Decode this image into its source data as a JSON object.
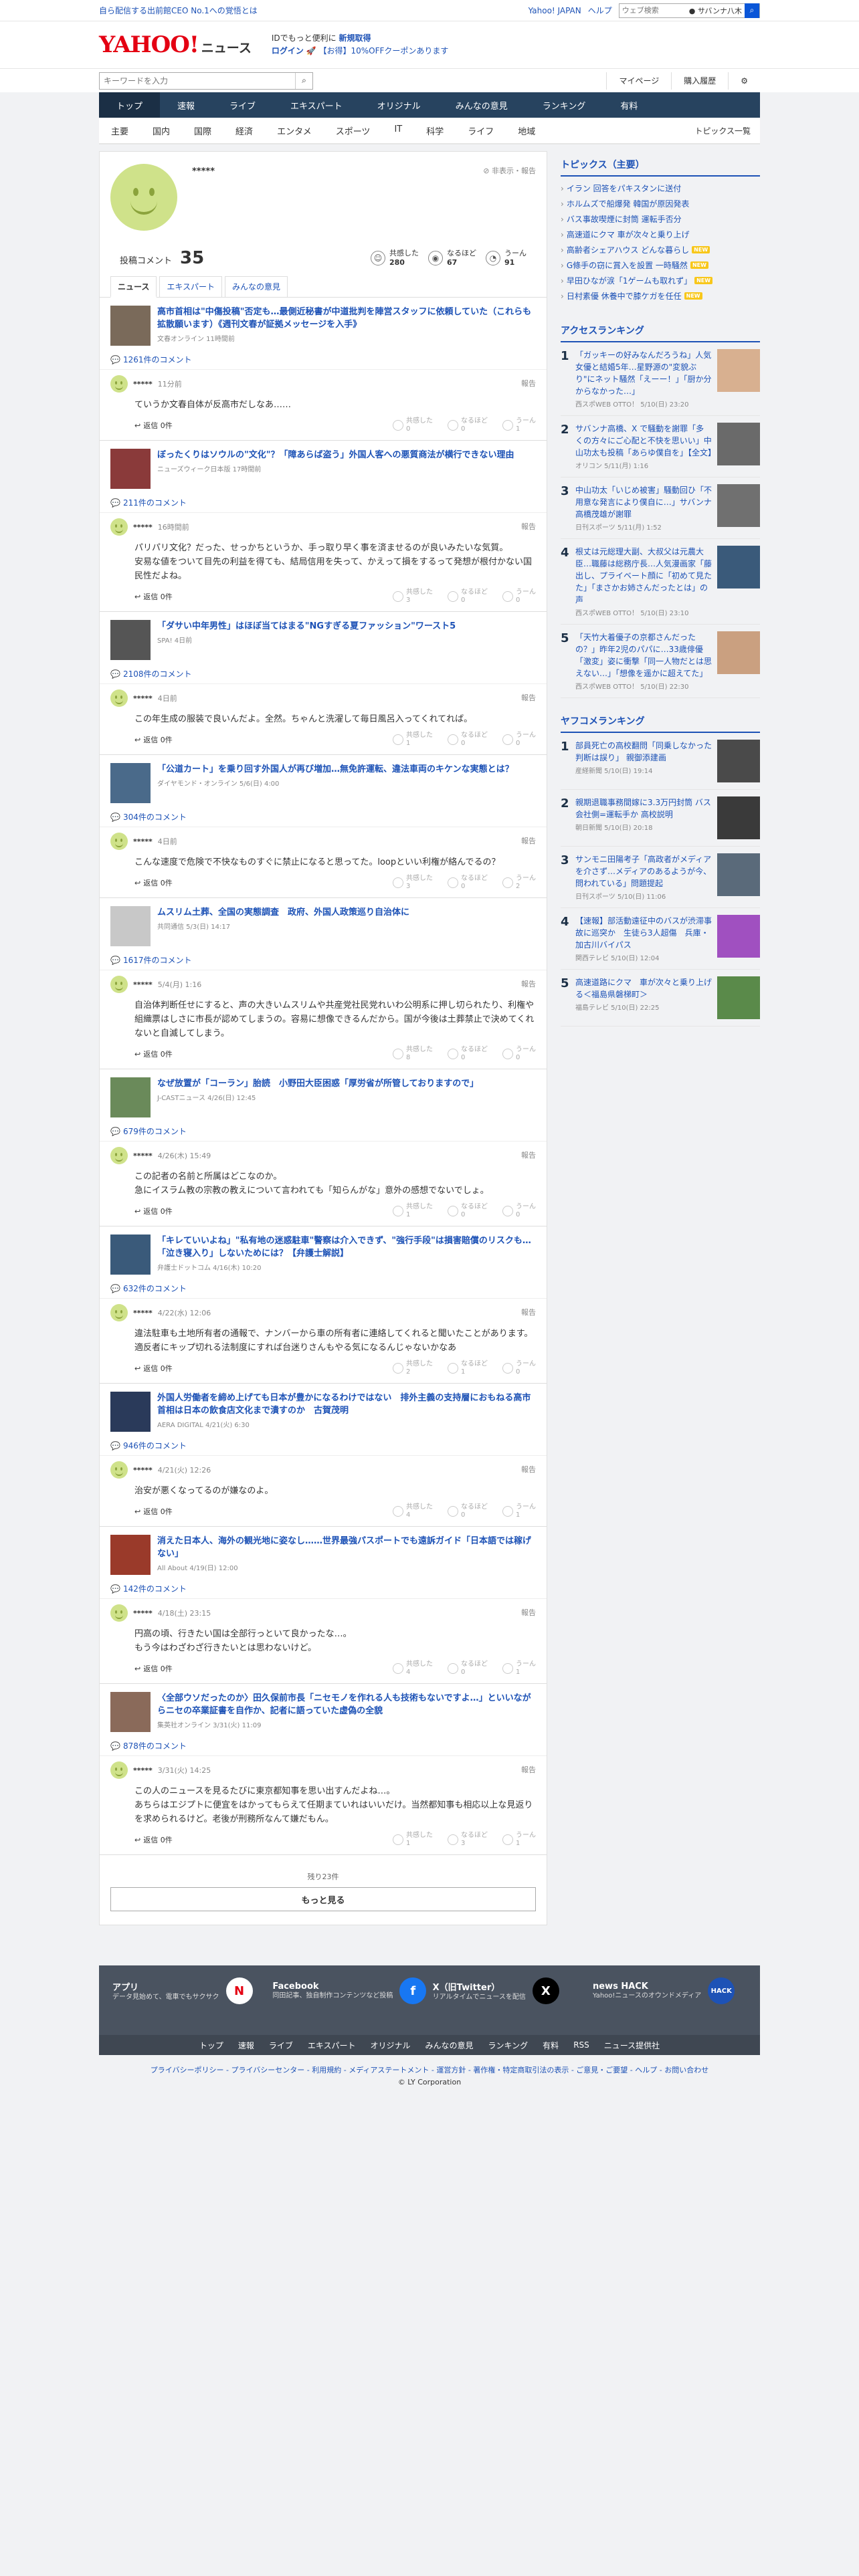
{
  "topbar": {
    "promo": "自ら配信する出前館CEO No.1への覚悟とは",
    "links": [
      "Yahoo! JAPAN",
      "ヘルプ"
    ],
    "search_placeholder": "ウェブ検索",
    "search_pill": "サバンナ八木"
  },
  "header": {
    "logo": "YAHOO!",
    "logo_jp": "JAPAN",
    "logo_news": "ニュース",
    "msg1_pre": "IDでもっと便利に",
    "msg1_link": "新規取得",
    "msg2_login": "ログイン",
    "msg2_rest": "【お得】10%OFFクーポンあります"
  },
  "toolrow": {
    "keyword_placeholder": "キーワードを入力",
    "mypage": "マイページ",
    "history": "購入履歴"
  },
  "nav": [
    "トップ",
    "速報",
    "ライブ",
    "エキスパート",
    "オリジナル",
    "みんなの意見",
    "ランキング",
    "有料"
  ],
  "subnav": [
    "主要",
    "国内",
    "国際",
    "経済",
    "エンタメ",
    "スポーツ",
    "IT",
    "科学",
    "ライフ",
    "地域"
  ],
  "subnav_right": "トピックス一覧",
  "profile": {
    "name": "*****",
    "report": "非表示・報告",
    "posted_label": "投稿コメント",
    "posted_count": "35",
    "reacts": [
      {
        "label": "共感した",
        "count": "280"
      },
      {
        "label": "なるほど",
        "count": "67"
      },
      {
        "label": "うーん",
        "count": "91"
      }
    ]
  },
  "tabs": [
    "ニュース",
    "エキスパート",
    "みんなの意見"
  ],
  "entries": [
    {
      "title": "高市首相は\"中傷投稿\"否定も…最側近秘書が中道批判を陣営スタッフに依頼していた（これらも拡散願います）《週刊文春が証拠メッセージを入手》",
      "source": "文春オンライン 11時間前",
      "count": "1261件のコメント",
      "time": "11分前",
      "text": "ていうか文春自体が反高市だしなあ……",
      "votes": [
        "0",
        "0",
        "1"
      ],
      "thumb": "#7a6a5a"
    },
    {
      "title": "ぼったくりはソウルの\"文化\"？「障あらば盗う」外国人客への悪質商法が横行できない理由",
      "source": "ニューズウィーク日本版 17時間前",
      "count": "211件のコメント",
      "time": "16時間前",
      "text": "パリパリ文化？だった、せっかちというか、手っ取り早く事を済ませるのが良いみたいな気質。\n安易な値をついて目先の利益を得ても、結局信用を失って、かえって損をするって発想が根付かない国民性だよね。",
      "votes": [
        "3",
        "0",
        "0"
      ],
      "thumb": "#8a3a3a"
    },
    {
      "title": "「ダサい中年男性」はほぼ当てはまる\"NGすぎる夏ファッション\"ワースト5",
      "source": "SPA! 4日前",
      "count": "2108件のコメント",
      "time": "4日前",
      "text": "この年生成の服装で良いんだよ。全然。ちゃんと洗濯して毎日風呂入ってくれてれば。",
      "votes": [
        "1",
        "0",
        "0"
      ],
      "thumb": "#555555"
    },
    {
      "title": "「公道カート」を乗り回す外国人が再び増加…無免許運転、違法車両のキケンな実態とは？",
      "source": "ダイヤモンド・オンライン 5/6(日) 4:00",
      "count": "304件のコメント",
      "time": "4日前",
      "text": "こんな速度で危険で不快なものすぐに禁止になると思ってた。loopといい利権が絡んでるの？",
      "votes": [
        "3",
        "0",
        "2"
      ],
      "thumb": "#4a6a8a"
    },
    {
      "title": "ムスリム土葬、全国の実態調査　政府、外国人政策巡り自治体に",
      "source": "共同通信 5/3(日) 14:17",
      "count": "1617件のコメント",
      "time": "5/4(月) 1:16",
      "text": "自治体判断任せにすると、声の大きいムスリムや共産党社民党れいわ公明系に押し切られたり、利権や組織票はしさに市長が認めてしまうの。容易に想像できるんだから。国が今後は土葬禁止で決めてくれないと自滅してしまう。",
      "votes": [
        "8",
        "0",
        "0"
      ],
      "thumb": "#c8c8c8"
    },
    {
      "title": "なぜ放置が「コーラン」胎読　小野田大臣困惑「厚労省が所管しておりますので」",
      "source": "J-CASTニュース 4/26(日) 12:45",
      "count": "679件のコメント",
      "time": "4/26(木) 15:49",
      "text": "この記者の名前と所属はどこなのか。\n急にイスラム教の宗教の教えについて言われても「知らんがな」意外の感想でないでしょ。",
      "votes": [
        "1",
        "0",
        "0"
      ],
      "thumb": "#6a8a5a"
    },
    {
      "title": "「キレていいよね」\"私有地の迷惑駐車\"警察は介入できず、\"強行手段\"は損害賠償のリスクも…「泣き寝入り」しないためには？【弁護士解説】",
      "source": "弁護士ドットコム 4/16(木) 10:20",
      "count": "632件のコメント",
      "time": "4/22(水) 12:06",
      "text": "違法駐車も土地所有者の通報で、ナンバーから車の所有者に連絡してくれると聞いたことがあります。\n適反者にキップ切れる法制度にすれば台迷りさんもやる気になるんじゃないかなあ",
      "votes": [
        "2",
        "1",
        "0"
      ],
      "thumb": "#3a5a7a"
    },
    {
      "title": "外国人労働者を締め上げても日本が豊かになるわけではない　排外主義の支持層におもねる高市首相は日本の飲食店文化まで潰すのか　古賀茂明",
      "source": "AERA DIGITAL 4/21(火) 6:30",
      "count": "946件のコメント",
      "time": "4/21(火) 12:26",
      "text": "治安が悪くなってるのが嫌なのよ。",
      "votes": [
        "4",
        "0",
        "1"
      ],
      "thumb": "#2a3a5a"
    },
    {
      "title": "消えた日本人、海外の観光地に姿なし……世界最強パスポートでも遠訴ガイド「日本語では稼げない」",
      "source": "All About 4/19(日) 12:00",
      "count": "142件のコメント",
      "time": "4/18(土) 23:15",
      "text": "円高の頃、行きたい国は全部行っといて良かったな…。\nもう今はわざわざ行きたいとは思わないけど。",
      "votes": [
        "4",
        "0",
        "1"
      ],
      "thumb": "#9a3a2a"
    },
    {
      "title": "〈全部ウソだったのか〉田久保前市長「ニセモノを作れる人も技術もないですよ…」といいながらニセの卒業証書を自作か、記者に語っていた虚偽の全貌",
      "source": "集英社オンライン 3/31(火) 11:09",
      "count": "878件のコメント",
      "time": "3/31(火) 14:25",
      "text": "この人のニュースを見るたびに東京都知事を思い出すんだよね…。\nあちらはエジプトに便宜をはかってもらえて任期まていれはいいだけ。当然都知事も相応以上な見返りを求められるけど。老後が刑務所なんて嫌だもん。",
      "votes": [
        "1",
        "3",
        "1"
      ],
      "thumb": "#8a6a5a"
    }
  ],
  "comment_report": "報告",
  "reply_label": "返信 0件",
  "vote_labels": [
    "共感した",
    "なるほど",
    "うーん"
  ],
  "remain": "残り23件",
  "more": "もっと見る",
  "topics": {
    "title": "トピックス（主要）",
    "items": [
      {
        "t": "イラン 回答をパキスタンに送付",
        "new": false
      },
      {
        "t": "ホルムズで船爆発 韓国が原因発表",
        "new": false
      },
      {
        "t": "バス事故喫煙に封筒 運転手否分",
        "new": false
      },
      {
        "t": "高速道にクマ 車が次々と乗り上げ",
        "new": false
      },
      {
        "t": "高齢者シェアハウス どんな暮らし",
        "new": true
      },
      {
        "t": "G條手の窃に賞入を設置 一時騒然",
        "new": true
      },
      {
        "t": "早田ひなが涙「1ゲームも取れず」",
        "new": true
      },
      {
        "t": "日村素優 休養中で膝ケガを任任",
        "new": true
      }
    ],
    "badge": "NEW"
  },
  "access": {
    "title": "アクセスランキング",
    "items": [
      {
        "t": "「ガッキーの好みなんだろうね」人気女優と結婚5年…星野源の\"変貌ぶり\"にネット騒然「えーー！」「厨か分からなかった…」",
        "s": "西スポWEB OTTO！ 5/10(日) 23:20",
        "c": "#d8b090"
      },
      {
        "t": "サバンナ高橋、X で騒動を謝罪「多くの方々にご心配と不快を思いい」中山功太も投稿「あらゆ僕自を」【全文】",
        "s": "オリコン 5/11(月) 1:16",
        "c": "#6a6a6a"
      },
      {
        "t": "中山功太「いじめ被害」騒動回ひ「不用意な発言により僕自に…」サバンナ高橋茂雄が謝罪",
        "s": "日刊スポーツ 5/11(月) 1:52",
        "c": "#707070"
      },
      {
        "t": "根丈は元総理大副、大叔父は元農大臣…職藤は総務庁長…人気漫画家「藤出し、プライベート顔に「初めて見たた」「まさかお姉さんだったとは」の声",
        "s": "西スポWEB OTTO！ 5/10(日) 23:10",
        "c": "#3a5a7a"
      },
      {
        "t": "「天竹大着優子の京都さんだったの？」昨年2児のパパに…33歳俳優「激変」姿に衝撃「同一人物だとは思えない…」「想像を遥かに超えてた」",
        "s": "西スポWEB OTTO！ 5/10(日) 22:30",
        "c": "#caa080"
      }
    ]
  },
  "yafuko": {
    "title": "ヤフコメランキング",
    "items": [
      {
        "t": "部員死亡の高校翻問「同乗しなかった判断は誤り」 親御添建画",
        "s": "産経新聞 5/10(日) 19:14",
        "c": "#4a4a4a"
      },
      {
        "t": "親期退職事務間嫁に3.3万円封筒 バス会社側=運転手か 高校説明",
        "s": "朝日新聞 5/10(日) 20:18",
        "c": "#3a3a3a"
      },
      {
        "t": "サンモニ田陽考子「高政者がメディアを介さず…メディアのあるようが今、問われている」問題提起",
        "s": "日刊スポーツ 5/10(日) 11:06",
        "c": "#5a6a7a"
      },
      {
        "t": "【速報】部活動遠征中のバスが渋滞事故に巡突か　生徒ら3人超傷　兵庫・加古川バイパス",
        "s": "関西テレビ 5/10(日) 12:04",
        "c": "#a050c0"
      },
      {
        "t": "高速道路にクマ　車が次々と乗り上げる＜福島県磐梯町＞",
        "s": "福島テレビ 5/10(日) 22:25",
        "c": "#5a8a4a"
      }
    ]
  },
  "footer": {
    "apps": [
      {
        "t": "アプリ",
        "d": "データ見始めて、電車でもサクサク",
        "icon": "N",
        "c": "#fff",
        "fc": "#e40012"
      },
      {
        "t": "Facebook",
        "d": "同田記事、独自制作コンテンツなど投稿",
        "icon": "f",
        "c": "#1877f2",
        "fc": "#fff"
      },
      {
        "t": "X（旧Twitter）",
        "d": "リアルタイムでニュースを配信",
        "icon": "X",
        "c": "#000",
        "fc": "#fff"
      },
      {
        "t": "news HACK",
        "d": "Yahoo!ニュースのオウンドメディア",
        "icon": "HACK",
        "c": "#1d52b6",
        "fc": "#fff"
      }
    ],
    "links": [
      "トップ",
      "速報",
      "ライブ",
      "エキスパート",
      "オリジナル",
      "みんなの意見",
      "ランキング",
      "有料",
      "RSS",
      "ニュース提供社"
    ],
    "bottom": "プライバシーポリシー - プライバシーセンター - 利用規約 - メディアステートメント - 運営方針 - 著作権・特定商取引法の表示 - ご意見・ご要望 - ヘルプ - お問い合わせ",
    "copy": "© LY Corporation"
  }
}
